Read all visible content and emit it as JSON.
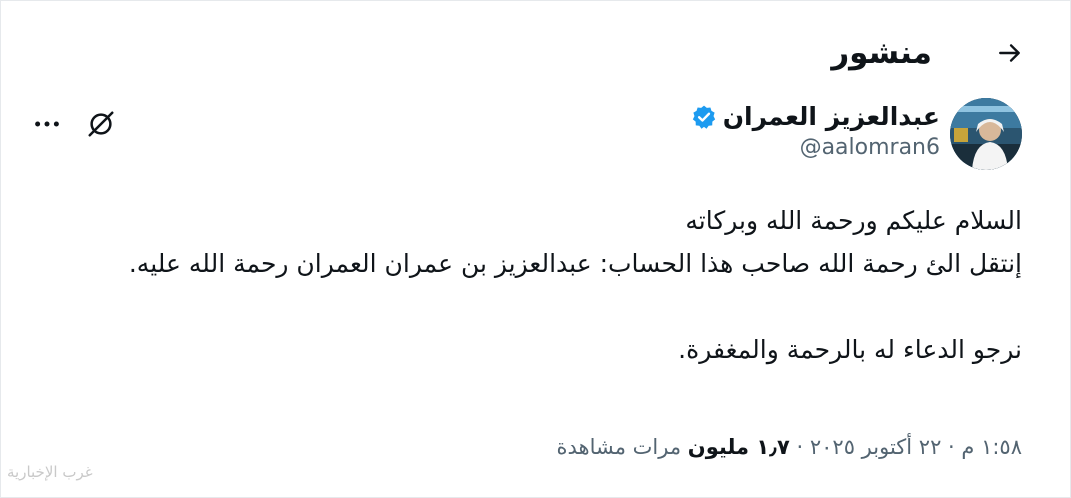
{
  "header": {
    "title": "منشور",
    "back_icon": "arrow-right-icon"
  },
  "author": {
    "display_name": "عبدالعزيز العمران",
    "handle": "@aalomran6",
    "verified_icon": "verified-badge-icon",
    "verified_color": "#1d9bf0"
  },
  "actions": {
    "grok_icon": "grok-icon",
    "more_icon": "more-horizontal-icon"
  },
  "post": {
    "text": "السلام عليكم ورحمة الله وبركاته\nإنتقل الئ رحمة الله صاحب هذا الحساب: عبدالعزيز بن عمران العمران رحمة الله عليه.\n\nنرجو الدعاء له بالرحمة والمغفرة."
  },
  "meta": {
    "time": "١:٥٨ م",
    "separator": " · ",
    "date": "٢٢ أكتوبر ٢٠٢٥",
    "views_count": "١٫٧ مليون",
    "views_label": " مرات مشاهدة"
  },
  "watermark": {
    "text": "غرب الإخبارية"
  }
}
